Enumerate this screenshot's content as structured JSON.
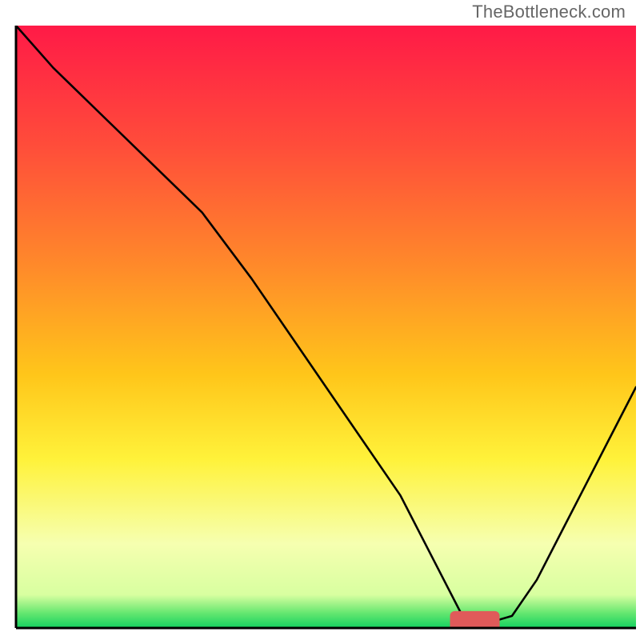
{
  "watermark": "TheBottleneck.com",
  "chart_data": {
    "type": "line",
    "title": "",
    "xlabel": "",
    "ylabel": "",
    "xlim": [
      0,
      100
    ],
    "ylim": [
      0,
      100
    ],
    "axes_visible": false,
    "grid": false,
    "background": {
      "description": "vertical gradient red→orange→yellow→pale→green",
      "stops": [
        {
          "pos": 0.0,
          "color": "#ff1a47"
        },
        {
          "pos": 0.2,
          "color": "#ff4d3a"
        },
        {
          "pos": 0.4,
          "color": "#ff8a2a"
        },
        {
          "pos": 0.58,
          "color": "#ffc61a"
        },
        {
          "pos": 0.72,
          "color": "#fff23a"
        },
        {
          "pos": 0.86,
          "color": "#f6ffb0"
        },
        {
          "pos": 0.945,
          "color": "#d8ffa0"
        },
        {
          "pos": 0.975,
          "color": "#66e770"
        },
        {
          "pos": 1.0,
          "color": "#14d160"
        }
      ]
    },
    "curve": {
      "description": "bottleneck curve: steep drop on the left, flat minimum near x≈72–78, rise toward the right",
      "x": [
        0,
        6,
        14,
        22,
        30,
        38,
        46,
        54,
        62,
        68,
        72,
        76,
        80,
        84,
        88,
        92,
        96,
        100
      ],
      "y": [
        100,
        93,
        85,
        77,
        69,
        58,
        46,
        34,
        22,
        10,
        2,
        0.8,
        2,
        8,
        16,
        24,
        32,
        40
      ]
    },
    "minimum_marker": {
      "x": 74,
      "y": 0.8,
      "rx": 4,
      "ry": 2,
      "color": "#e05a5a"
    },
    "frame": {
      "left": true,
      "bottom": true,
      "right": false,
      "top": false,
      "color": "#000000",
      "width": 3
    }
  }
}
